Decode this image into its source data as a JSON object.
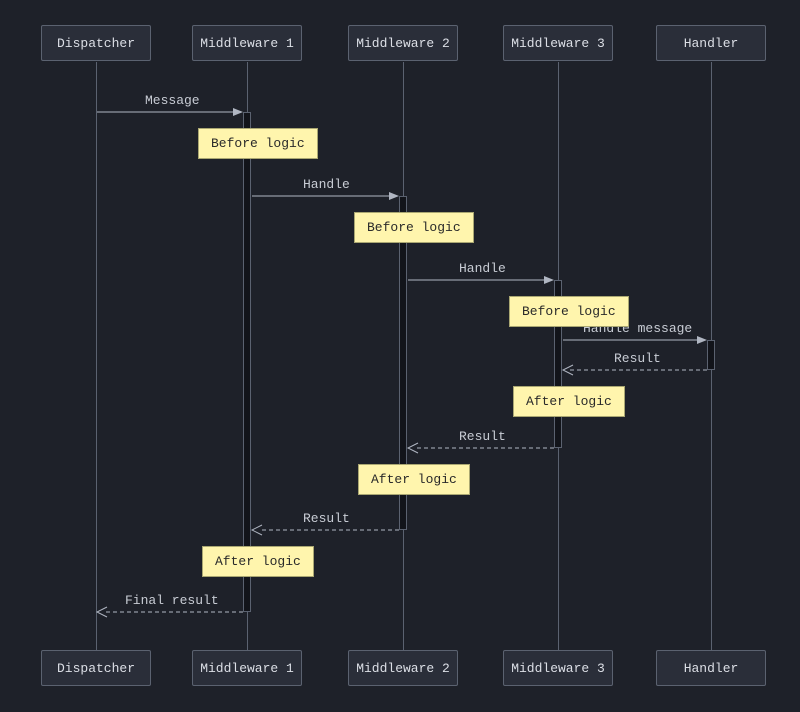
{
  "chart_data": {
    "type": "sequence-diagram",
    "participants": [
      {
        "id": "dispatcher",
        "label": "Dispatcher"
      },
      {
        "id": "mw1",
        "label": "Middleware 1"
      },
      {
        "id": "mw2",
        "label": "Middleware 2"
      },
      {
        "id": "mw3",
        "label": "Middleware 3"
      },
      {
        "id": "handler",
        "label": "Handler"
      }
    ],
    "messages": {
      "dispatch_to_mw1": "Message",
      "mw1_to_mw2": "Handle",
      "mw2_to_mw3": "Handle",
      "mw3_to_handler": "Handle message",
      "handler_to_mw3": "Result",
      "mw3_to_mw2": "Result",
      "mw2_to_mw1": "Result",
      "mw1_to_dispatch": "Final result"
    },
    "notes": {
      "mw1_before": "Before logic",
      "mw2_before": "Before logic",
      "mw3_before": "Before logic",
      "mw3_after": "After logic",
      "mw2_after": "After logic",
      "mw1_after": "After logic"
    }
  }
}
